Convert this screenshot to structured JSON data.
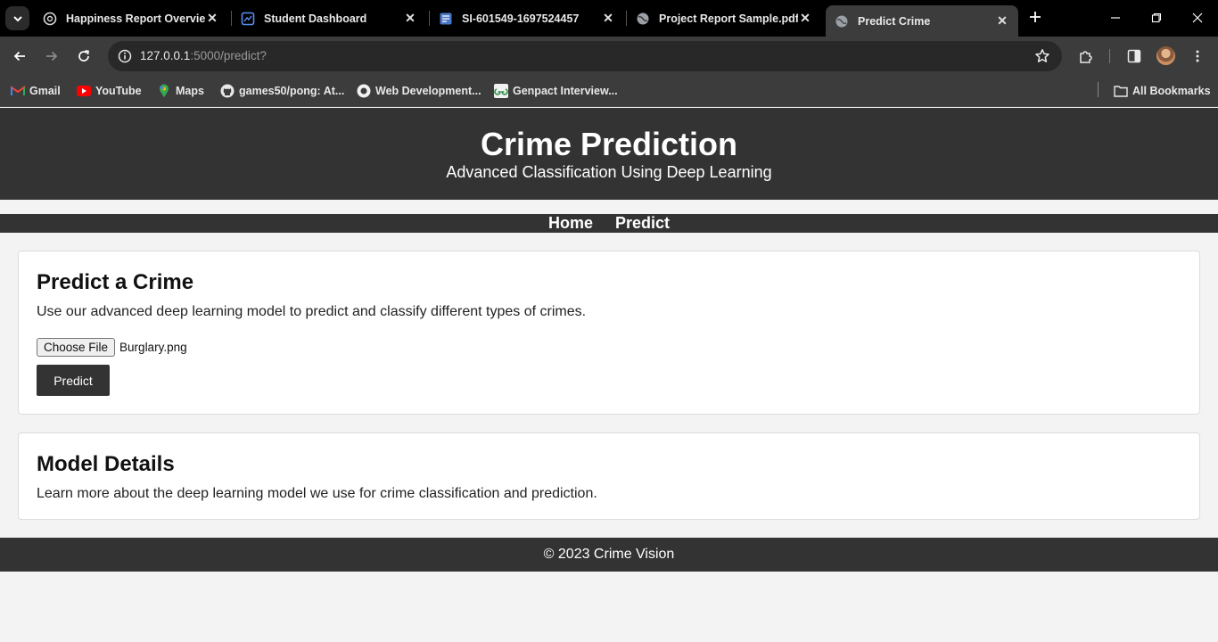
{
  "browser": {
    "tabs": [
      {
        "title": "Happiness Report Overview",
        "icon": "chatgpt-icon"
      },
      {
        "title": "Student Dashboard",
        "icon": "dashboard-icon"
      },
      {
        "title": "SI-601549-1697524457",
        "icon": "document-icon"
      },
      {
        "title": "Project Report Sample.pdf",
        "icon": "globe-icon"
      },
      {
        "title": "Predict Crime",
        "icon": "globe-icon",
        "active": true
      }
    ],
    "url": {
      "host": "127.0.0.1",
      "path": ":5000/predict?"
    },
    "bookmarks": [
      {
        "label": "Gmail",
        "icon": "gmail-icon"
      },
      {
        "label": "YouTube",
        "icon": "youtube-icon"
      },
      {
        "label": "Maps",
        "icon": "maps-icon"
      },
      {
        "label": "games50/pong: At...",
        "icon": "github-icon"
      },
      {
        "label": "Web Development...",
        "icon": "web-icon"
      },
      {
        "label": "Genpact Interview...",
        "icon": "gfg-icon"
      }
    ],
    "all_bookmarks_label": "All Bookmarks"
  },
  "hero": {
    "title": "Crime Prediction",
    "subtitle": "Advanced Classification Using Deep Learning"
  },
  "nav": {
    "home": "Home",
    "predict": "Predict"
  },
  "predict_card": {
    "heading": "Predict a Crime",
    "description": "Use our advanced deep learning model to predict and classify different types of crimes.",
    "choose_file_label": "Choose File",
    "file_name": "Burglary.png",
    "submit_label": "Predict"
  },
  "model_card": {
    "heading": "Model Details",
    "description": "Learn more about the deep learning model we use for crime classification and prediction."
  },
  "footer": {
    "text": "© 2023 Crime Vision"
  },
  "colors": {
    "header_bg": "#333333",
    "page_bg": "#f3f3f3",
    "card_bg": "#ffffff"
  }
}
